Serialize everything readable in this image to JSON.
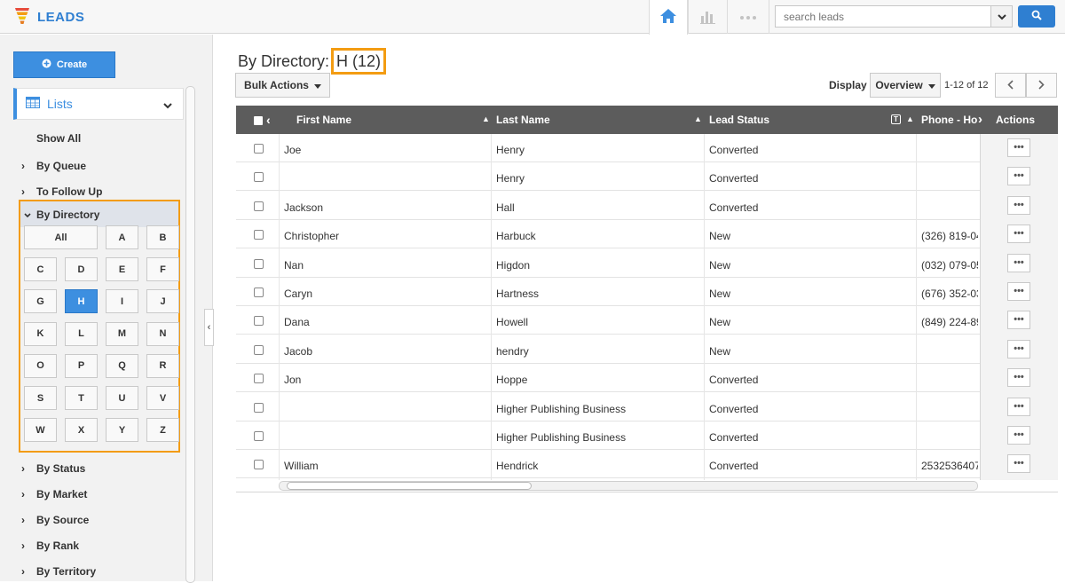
{
  "app": {
    "title": "LEADS"
  },
  "search": {
    "placeholder": "search leads"
  },
  "sidebar": {
    "create_label": "Create",
    "lists_label": "Lists",
    "show_all": "Show All",
    "items_top": [
      "By Queue",
      "To Follow Up"
    ],
    "directory_label": "By Directory",
    "letters": [
      "All",
      "A",
      "B",
      "C",
      "D",
      "E",
      "F",
      "G",
      "H",
      "I",
      "J",
      "K",
      "L",
      "M",
      "N",
      "O",
      "P",
      "Q",
      "R",
      "S",
      "T",
      "U",
      "V",
      "W",
      "X",
      "Y",
      "Z"
    ],
    "active_letter": "H",
    "items_bottom": [
      "By Status",
      "By Market",
      "By Source",
      "By Rank",
      "By Territory"
    ]
  },
  "main": {
    "title_prefix": "By Directory:",
    "title_highlight": "H (12)",
    "bulk_actions": "Bulk Actions",
    "display_label": "Display",
    "display_value": "Overview",
    "pager_text": "1-12 of 12"
  },
  "table": {
    "columns": [
      "First Name",
      "Last Name",
      "Lead Status",
      "Phone - Ho",
      "Actions"
    ],
    "action_label": "•••",
    "rows": [
      {
        "first": "Joe",
        "last": "Henry",
        "status": "Converted",
        "phone": ""
      },
      {
        "first": "",
        "last": "Henry",
        "status": "Converted",
        "phone": ""
      },
      {
        "first": "Jackson",
        "last": "Hall",
        "status": "Converted",
        "phone": ""
      },
      {
        "first": "Christopher",
        "last": "Harbuck",
        "status": "New",
        "phone": "(326) 819-04"
      },
      {
        "first": "Nan",
        "last": "Higdon",
        "status": "New",
        "phone": "(032) 079-05"
      },
      {
        "first": "Caryn",
        "last": "Hartness",
        "status": "New",
        "phone": "(676) 352-03"
      },
      {
        "first": "Dana",
        "last": "Howell",
        "status": "New",
        "phone": "(849) 224-89"
      },
      {
        "first": "Jacob",
        "last": "hendry",
        "status": "New",
        "phone": ""
      },
      {
        "first": "Jon",
        "last": "Hoppe",
        "status": "Converted",
        "phone": ""
      },
      {
        "first": "",
        "last": "Higher Publishing Business",
        "status": "Converted",
        "phone": ""
      },
      {
        "first": "",
        "last": "Higher Publishing Business",
        "status": "Converted",
        "phone": ""
      },
      {
        "first": "William",
        "last": "Hendrick",
        "status": "Converted",
        "phone": "2532536407"
      }
    ]
  },
  "colors": {
    "accent": "#3d8fe0",
    "highlight": "#f39c12",
    "header": "#5c5c5c"
  }
}
